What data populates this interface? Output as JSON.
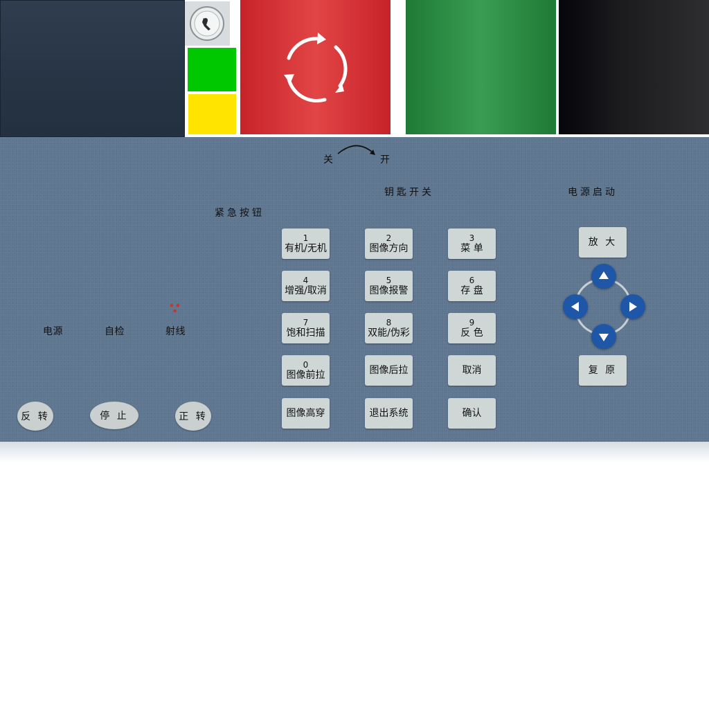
{
  "labels": {
    "off": "关",
    "on": "开",
    "key_switch": "钥匙开关",
    "power_start": "电源启动",
    "emergency": "紧急按钮",
    "power": "电源",
    "selftest": "自检",
    "ray": "射线"
  },
  "motor": {
    "reverse": "反 转",
    "stop": "停 止",
    "forward": "正 转"
  },
  "keypad": [
    {
      "num": "1",
      "label": "有机/无机"
    },
    {
      "num": "2",
      "label": "图像方向"
    },
    {
      "num": "3",
      "label": "菜 单"
    },
    {
      "num": "4",
      "label": "增强/取消"
    },
    {
      "num": "5",
      "label": "图像报警"
    },
    {
      "num": "6",
      "label": "存 盘"
    },
    {
      "num": "7",
      "label": "饱和扫描"
    },
    {
      "num": "8",
      "label": "双能/伪彩"
    },
    {
      "num": "9",
      "label": "反 色"
    },
    {
      "num": "0",
      "label": "图像前拉"
    },
    {
      "num": "",
      "label": "图像后拉"
    },
    {
      "num": "",
      "label": "取消"
    },
    {
      "num": "",
      "label": "图像高穿"
    },
    {
      "num": "",
      "label": "退出系统"
    },
    {
      "num": "",
      "label": "确认"
    }
  ],
  "nav": {
    "zoom": "放 大",
    "reset": "复 原"
  },
  "icons": {
    "refresh": "refresh-icon",
    "camera": "camera-icon",
    "up": "arrow-up-icon",
    "down": "arrow-down-icon",
    "left": "arrow-left-icon",
    "right": "arrow-right-icon"
  },
  "colors": {
    "panel": "#5f7690",
    "red": "#d83536",
    "green": "#2a8b44",
    "black": "#111114",
    "status_green": "#00c800",
    "status_yellow": "#ffe400",
    "nav_blue": "#1f57a8",
    "key_face": "#cfd6d6"
  }
}
